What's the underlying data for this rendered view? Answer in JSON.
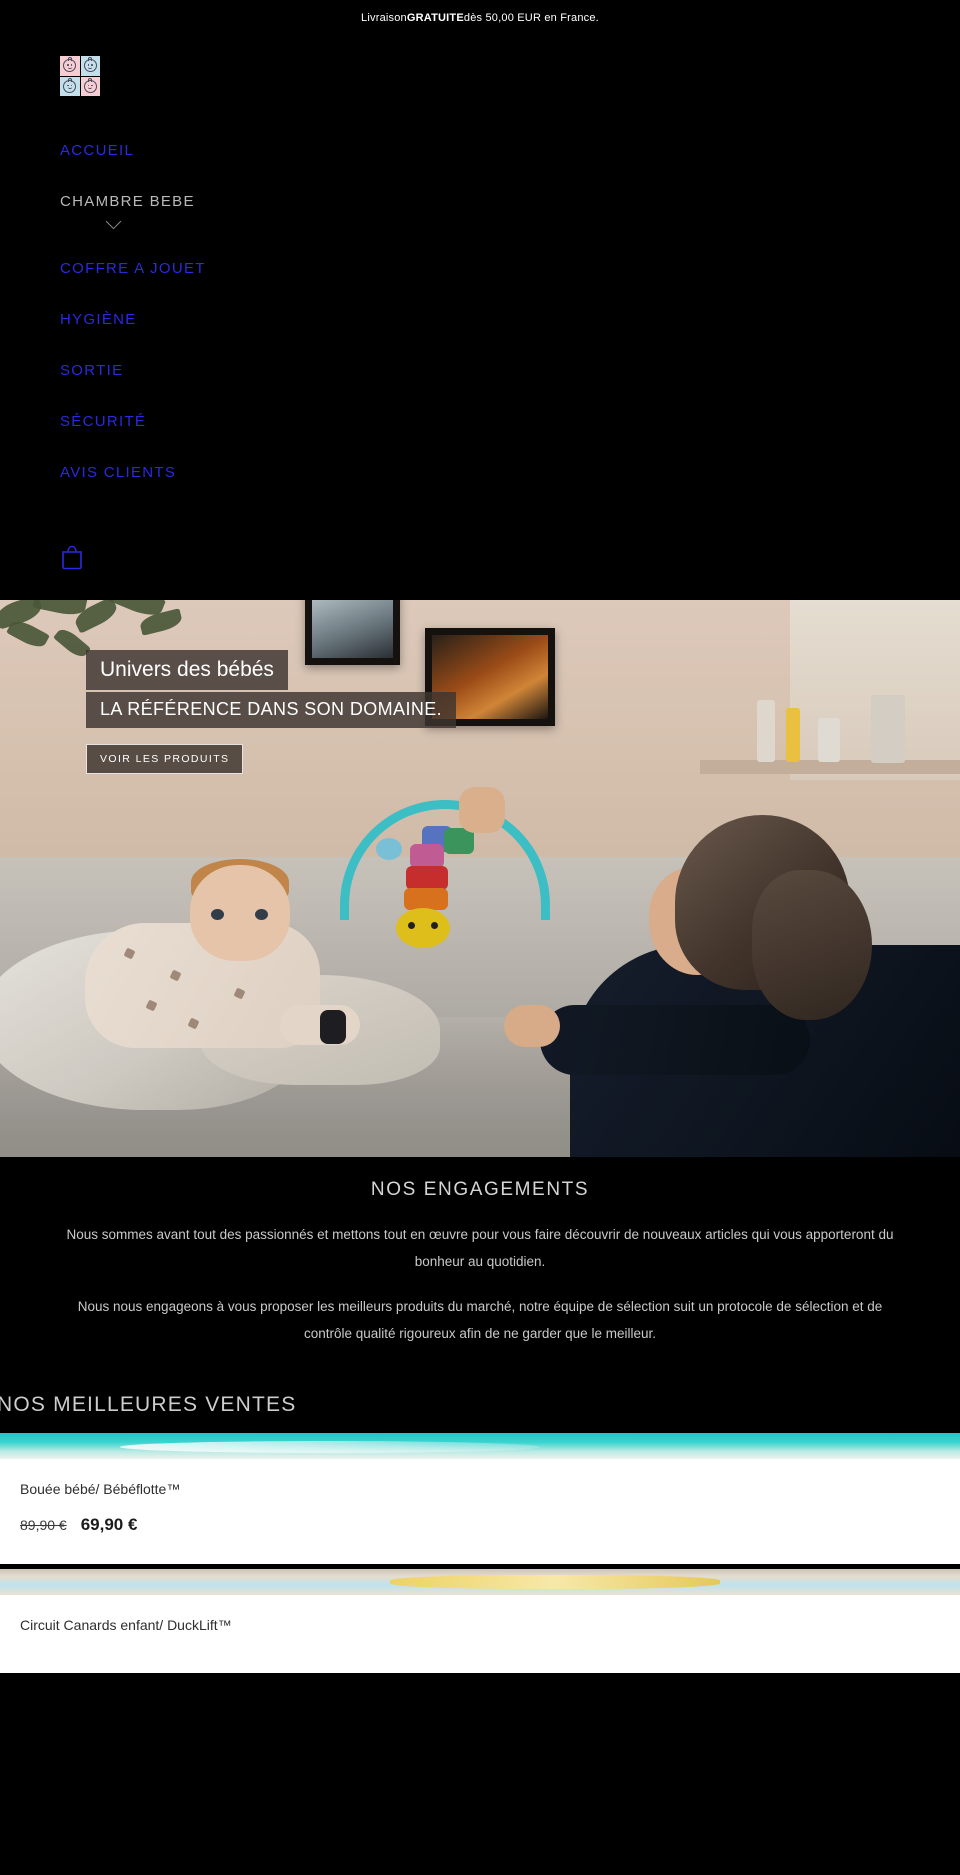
{
  "announcement": {
    "prefix": "Livraison ",
    "highlight": "GRATUITE",
    "suffix": " dès 50,00 EUR en France."
  },
  "brand": {
    "logo_name": "baby-faces-logo",
    "colors": {
      "pink": "#f6cdd3",
      "blue": "#c3dfe9",
      "link": "#2a2ae0"
    }
  },
  "nav": {
    "items": [
      {
        "label": "ACCUEIL",
        "has_dropdown": false
      },
      {
        "label": "CHAMBRE BEBE",
        "has_dropdown": true
      },
      {
        "label": "COFFRE A JOUET",
        "has_dropdown": false
      },
      {
        "label": "HYGIÈNE",
        "has_dropdown": false
      },
      {
        "label": "SORTIE",
        "has_dropdown": false
      },
      {
        "label": "SÉCURITÉ",
        "has_dropdown": false
      },
      {
        "label": "AVIS CLIENTS",
        "has_dropdown": false
      }
    ],
    "cart_icon": "shopping-bag-icon"
  },
  "hero": {
    "title": "Univers des bébés",
    "subtitle": "LA RÉFÉRENCE DANS SON DOMAINE.",
    "cta": "VOIR LES PRODUITS"
  },
  "engagements": {
    "title": "NOS ENGAGEMENTS",
    "paragraph1": "Nous sommes avant tout des passionnés et mettons tout en œuvre pour vous faire découvrir de nouveaux articles qui vous apporteront du bonheur au quotidien.",
    "paragraph2": "Nous nous engageons à vous proposer les meilleurs produits du marché, notre équipe de sélection suit un protocole de sélection et de contrôle qualité rigoureux afin de ne garder que le meilleur."
  },
  "bestsellers": {
    "title": "NOS MEILLEURES VENTES",
    "products": [
      {
        "name": "Bouée bébé/ Bébéflotte™",
        "price_old": "89,90 €",
        "price_new": "69,90 €"
      },
      {
        "name": "Circuit Canards enfant/ DuckLift™",
        "price_old": "",
        "price_new": ""
      }
    ]
  }
}
